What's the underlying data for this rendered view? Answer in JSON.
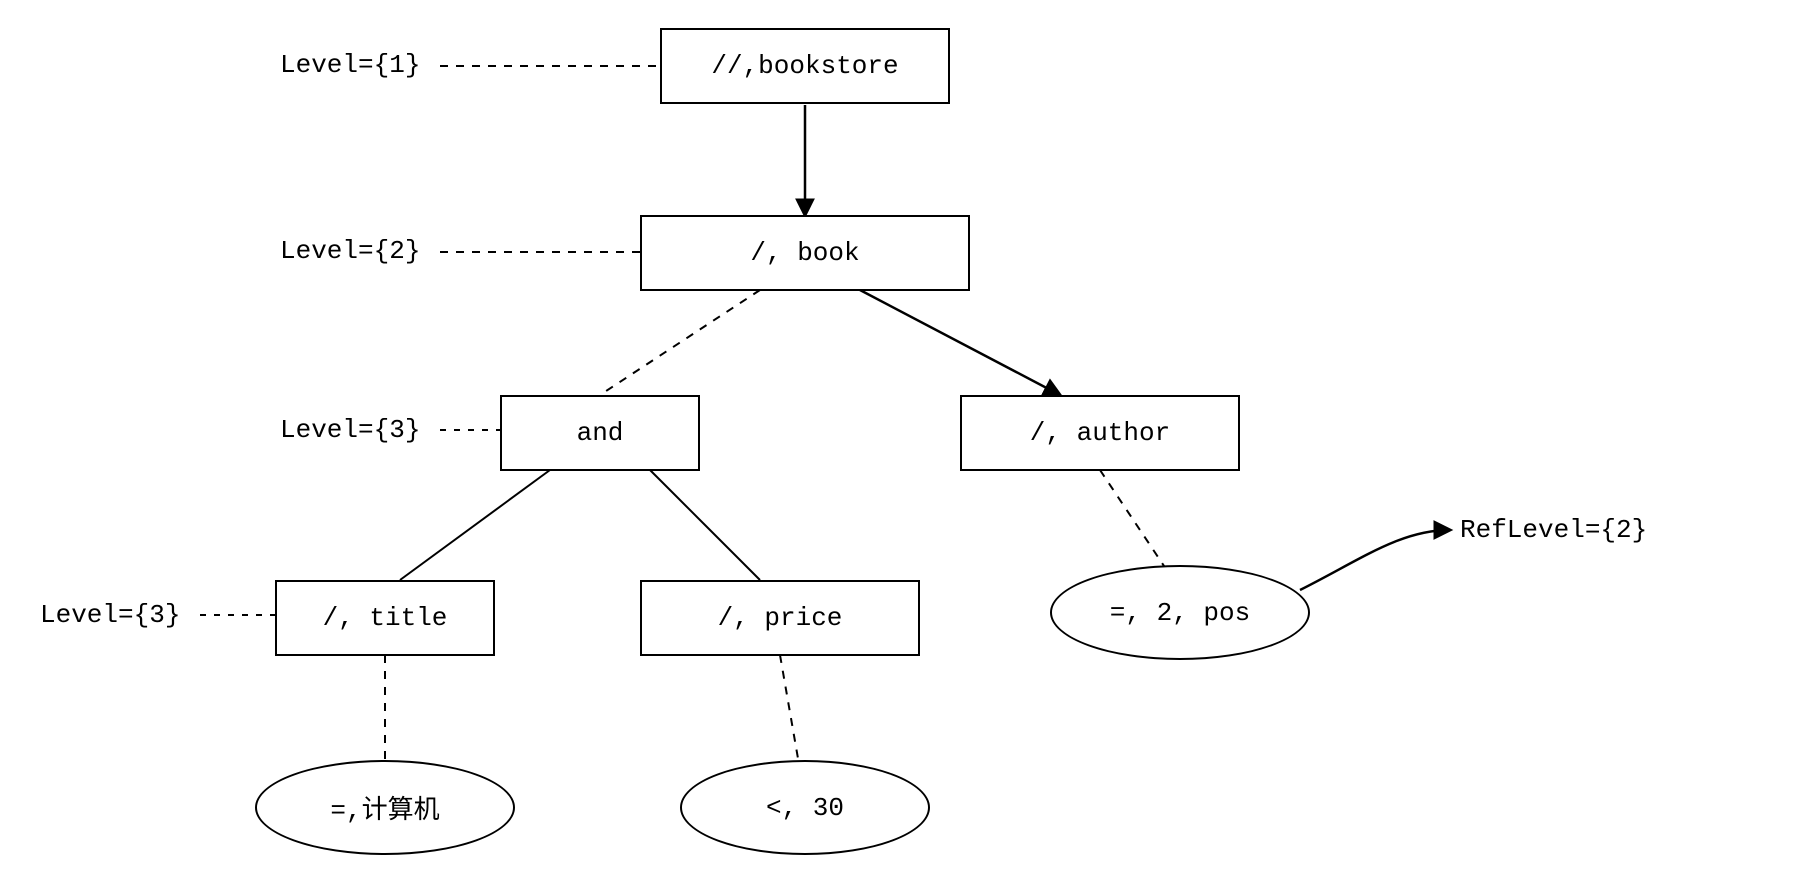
{
  "labels": {
    "level1": "Level={1}",
    "level2": "Level={2}",
    "level3a": "Level={3}",
    "level3b": "Level={3}",
    "refLevel": "RefLevel={2}"
  },
  "nodes": {
    "bookstore": "//,bookstore",
    "book": "/, book",
    "and": "and",
    "author": "/, author",
    "title": "/, title",
    "price": "/, price",
    "pos": "=, 2, pos",
    "titleCond": "=,计算机",
    "priceCond": "<, 30"
  }
}
